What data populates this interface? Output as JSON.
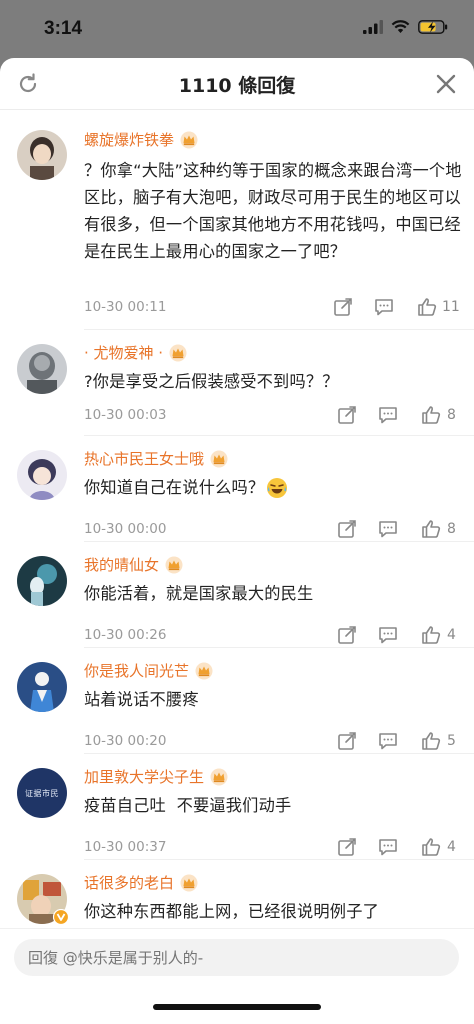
{
  "status_bar": {
    "time": "3:14"
  },
  "header": {
    "title": "1110 條回復"
  },
  "colors": {
    "username": "#e8742a",
    "timestamp": "#9a9a9a",
    "battery": "#f4c430"
  },
  "comments": [
    {
      "username": "螺旋爆炸铁拳",
      "text": "？你拿“大陆”这种约等于国家的概念来跟台湾一个地区比，脑子有大泡吧，财政尽可用于民生的地区可以有很多，但一个国家其他地方不用花钱吗，中国已经是在民生上最用心的国家之一了吧？",
      "time": "10-30 00:11",
      "likes": "11"
    },
    {
      "username": "· 尤物爱神 ·",
      "text": "?你是享受之后假装感受不到吗？？",
      "time": "10-30 00:03",
      "likes": "8"
    },
    {
      "username": "热心市民王女士哦",
      "text": "你知道自己在说什么吗？",
      "emoji": "crying-laughing-emoji",
      "time": "10-30 00:00",
      "likes": "8"
    },
    {
      "username": "我的晴仙女",
      "text": "你能活着，就是国家最大的民生",
      "time": "10-30 00:26",
      "likes": "4"
    },
    {
      "username": "你是我人间光芒",
      "text": "站着说话不腰疼",
      "time": "10-30 00:20",
      "likes": "5"
    },
    {
      "username": "加里敦大学尖子生",
      "avatar_text": "证据市民",
      "text": "疫苗自己吐  不要逼我们动手",
      "time": "10-30 00:37",
      "likes": "4"
    },
    {
      "username": "话很多的老白",
      "text": "你这种东西都能上网，已经很说明例子了"
    }
  ],
  "reply": {
    "placeholder": "回復 @快乐是属于别人的-"
  }
}
